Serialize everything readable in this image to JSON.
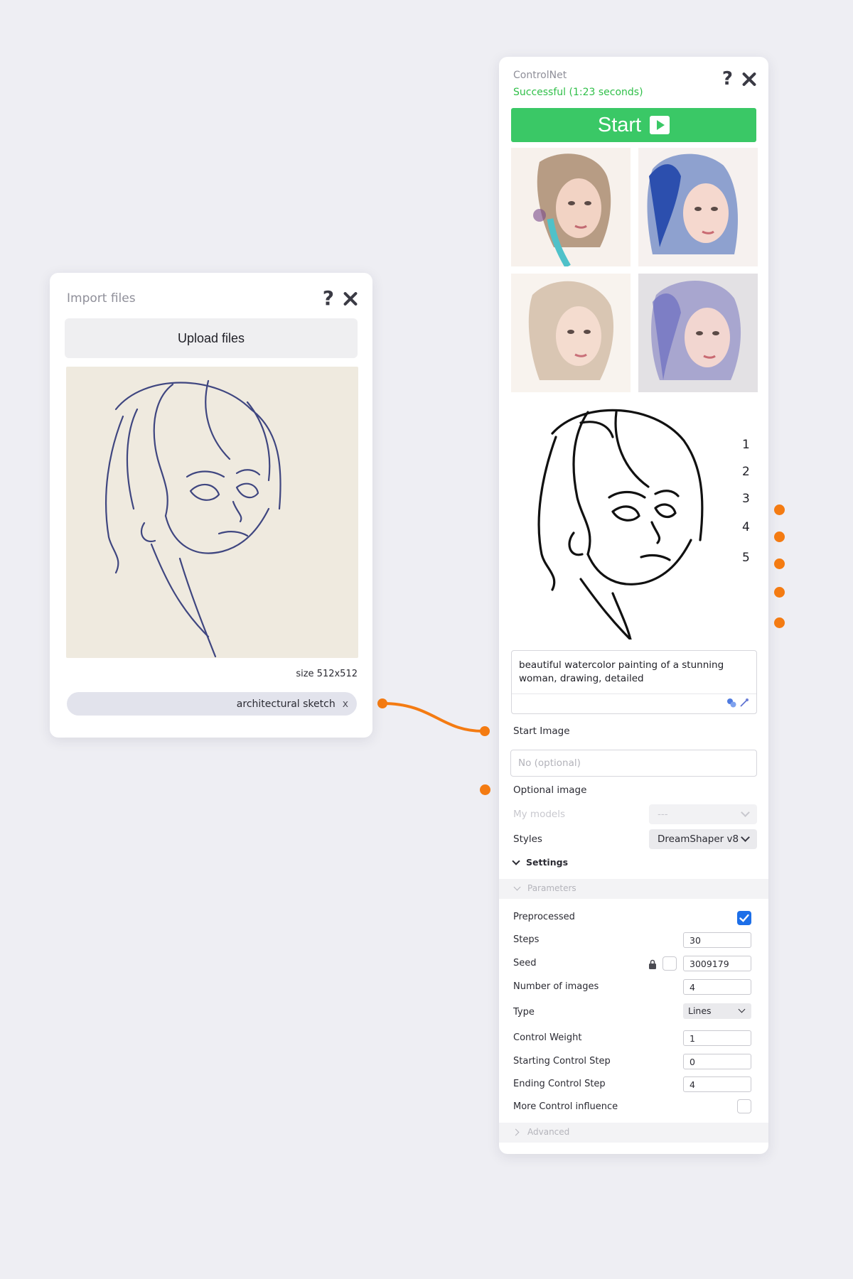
{
  "colors": {
    "background": "#eeeef3",
    "accent": "#3ac866",
    "success_text": "#2fbf48",
    "connector": "#f47b12",
    "checkbox": "#1d6fe8"
  },
  "import_panel": {
    "title": "Import files",
    "upload_label": "Upload files",
    "image_icon": "pencil-sketch-portrait",
    "size_label": "size 512x512",
    "file_chip": {
      "label": "architectural sketch",
      "remove": "x"
    }
  },
  "controlnet": {
    "title": "ControlNet",
    "status": "Successful (1:23 seconds)",
    "start_label": "Start",
    "results": [
      "watercolor-portrait-1",
      "watercolor-portrait-2",
      "watercolor-portrait-3",
      "watercolor-portrait-4"
    ],
    "line_art_icon": "line-art-portrait",
    "output_numbers": [
      "1",
      "2",
      "3",
      "4",
      "5"
    ],
    "prompt": "beautiful watercolor painting of a stunning woman, drawing, detailed",
    "start_image_label": "Start Image",
    "start_image_placeholder": "No (optional)",
    "optional_image_label": "Optional image",
    "my_models_label": "My models",
    "my_models_value": "---",
    "styles_label": "Styles",
    "styles_value": "DreamShaper v8",
    "settings_label": "Settings",
    "parameters_label": "Parameters",
    "advanced_label": "Advanced",
    "params": {
      "preprocessed": {
        "label": "Preprocessed",
        "checked": true
      },
      "steps": {
        "label": "Steps",
        "value": "30"
      },
      "seed": {
        "label": "Seed",
        "value": "3009179"
      },
      "num_images": {
        "label": "Number of images",
        "value": "4"
      },
      "type": {
        "label": "Type",
        "value": "Lines"
      },
      "control_weight": {
        "label": "Control Weight",
        "value": "1"
      },
      "start_step": {
        "label": "Starting Control Step",
        "value": "0"
      },
      "end_step": {
        "label": "Ending Control Step",
        "value": "4"
      },
      "more_influence": {
        "label": "More Control influence",
        "checked": false
      }
    }
  }
}
